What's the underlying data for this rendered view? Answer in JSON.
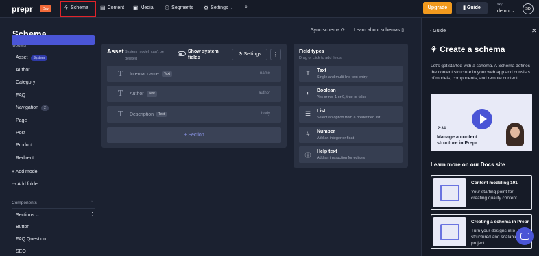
{
  "topbar": {
    "logo": "prepr",
    "env_badge": "Dev",
    "nav": [
      {
        "label": "Schema",
        "icon": "schema-icon"
      },
      {
        "label": "Content",
        "icon": "content-icon"
      },
      {
        "label": "Media",
        "icon": "media-icon"
      },
      {
        "label": "Segments",
        "icon": "segments-icon"
      },
      {
        "label": "Settings",
        "icon": "gear-icon"
      }
    ],
    "upgrade": "Upgrade",
    "guide": "Guide",
    "workspace_top": "sky",
    "workspace": "demo",
    "avatar": "SD",
    "accent": "#f29a1e",
    "highlight": "#e0242a"
  },
  "sidebar": {
    "title": "Schema",
    "models_label": "Models",
    "models": [
      "Asset",
      "Author",
      "Category",
      "FAQ",
      "Navigation",
      "Page",
      "Post",
      "Product",
      "Redirect"
    ],
    "asset_badge": "System",
    "nav_badge": "2",
    "add_model": "Add model",
    "add_folder": "Add folder",
    "components_label": "Components",
    "components": [
      "Sections",
      "Button",
      "FAQ Question",
      "SEO"
    ]
  },
  "main": {
    "sync": "Sync schema",
    "learn": "Learn about schemas",
    "model_title": "Asset",
    "system_note": "System model, can't be deleted",
    "show_system": "Show system fields",
    "settings": "Settings",
    "fields": [
      {
        "name": "Internal name",
        "type": "Text",
        "api": "name"
      },
      {
        "name": "Author",
        "type": "Text",
        "api": "author"
      },
      {
        "name": "Description",
        "type": "Text",
        "api": "body"
      }
    ],
    "add_section": "+ Section"
  },
  "field_types": {
    "title": "Field types",
    "subtitle": "Drag or click to add fields",
    "items": [
      {
        "name": "Text",
        "desc": "Single and multi line text entry",
        "icon": "text-icon"
      },
      {
        "name": "Boolean",
        "desc": "Yes or no, 1 or 0, true or false",
        "icon": "toggle-icon"
      },
      {
        "name": "List",
        "desc": "Select an option from a predefined list",
        "icon": "list-icon"
      },
      {
        "name": "Number",
        "desc": "Add an integer or float",
        "icon": "number-icon"
      },
      {
        "name": "Help text",
        "desc": "Add an instruction for editors",
        "icon": "info-icon"
      }
    ]
  },
  "guide": {
    "back": "Guide",
    "title": "Create a schema",
    "intro": "Let's get started with a schema. A Schema defines the content structure in your web app and consists of models, components, and remote content.",
    "video_time": "2:34",
    "video_caption": "Manage a content structure in Prepr",
    "docs_title": "Learn more on our Docs site",
    "cards": [
      {
        "title": "Content modeling 101",
        "desc": "Your starting point for creating quality content."
      },
      {
        "title": "Creating a schema in Prepr",
        "desc": "Turn your designs into structured and scalable project."
      }
    ]
  }
}
